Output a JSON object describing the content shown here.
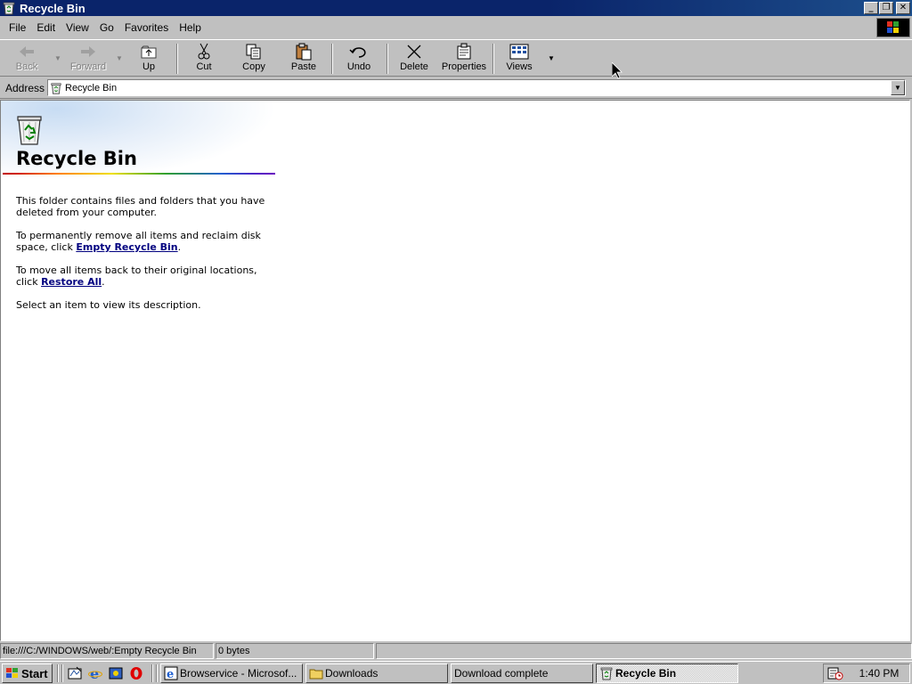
{
  "window": {
    "title": "Recycle Bin",
    "icon": "recycle-bin-icon",
    "buttons": {
      "minimize": "_",
      "maximize": "❐",
      "close": "✕"
    }
  },
  "menubar": {
    "items": [
      "File",
      "Edit",
      "View",
      "Go",
      "Favorites",
      "Help"
    ]
  },
  "toolbar": {
    "back": {
      "label": "Back",
      "icon": "back-arrow-icon",
      "enabled": false
    },
    "forward": {
      "label": "Forward",
      "icon": "forward-arrow-icon",
      "enabled": false
    },
    "up": {
      "label": "Up",
      "icon": "up-folder-icon"
    },
    "cut": {
      "label": "Cut",
      "icon": "scissors-icon"
    },
    "copy": {
      "label": "Copy",
      "icon": "copy-icon"
    },
    "paste": {
      "label": "Paste",
      "icon": "paste-icon"
    },
    "undo": {
      "label": "Undo",
      "icon": "undo-icon"
    },
    "delete": {
      "label": "Delete",
      "icon": "delete-x-icon"
    },
    "properties": {
      "label": "Properties",
      "icon": "properties-icon"
    },
    "views": {
      "label": "Views",
      "icon": "views-icon"
    }
  },
  "address": {
    "label": "Address",
    "value": "Recycle Bin"
  },
  "content": {
    "title": "Recycle Bin",
    "para1": "This folder contains files and folders that you have deleted from your computer.",
    "para2_prefix": "To permanently remove all items and reclaim disk space, click ",
    "empty_link": "Empty Recycle Bin",
    "para2_suffix": ".",
    "para3_prefix": "To move all items back to their original locations, click ",
    "restore_link": "Restore All",
    "para3_suffix": ".",
    "para4": "Select an item to view its description."
  },
  "statusbar": {
    "url": "file:///C:/WINDOWS/web/:Empty Recycle Bin",
    "size": "0 bytes",
    "zone": ""
  },
  "taskbar": {
    "start_label": "Start",
    "quicklaunch": [
      "show-desktop-icon",
      "internet-explorer-icon",
      "channels-icon",
      "opera-icon"
    ],
    "tasks": [
      {
        "label": "Browservice - Microsof...",
        "icon": "internet-explorer-icon",
        "active": false
      },
      {
        "label": "Downloads",
        "icon": "folder-icon",
        "active": false
      },
      {
        "label": "Download complete",
        "icon": "",
        "active": false
      },
      {
        "label": "Recycle Bin",
        "icon": "recycle-bin-icon",
        "active": true
      }
    ],
    "clock": "1:40 PM"
  },
  "colors": {
    "titlebar": "#0a246a",
    "face": "#c0c0c0",
    "link": "#00007f"
  }
}
